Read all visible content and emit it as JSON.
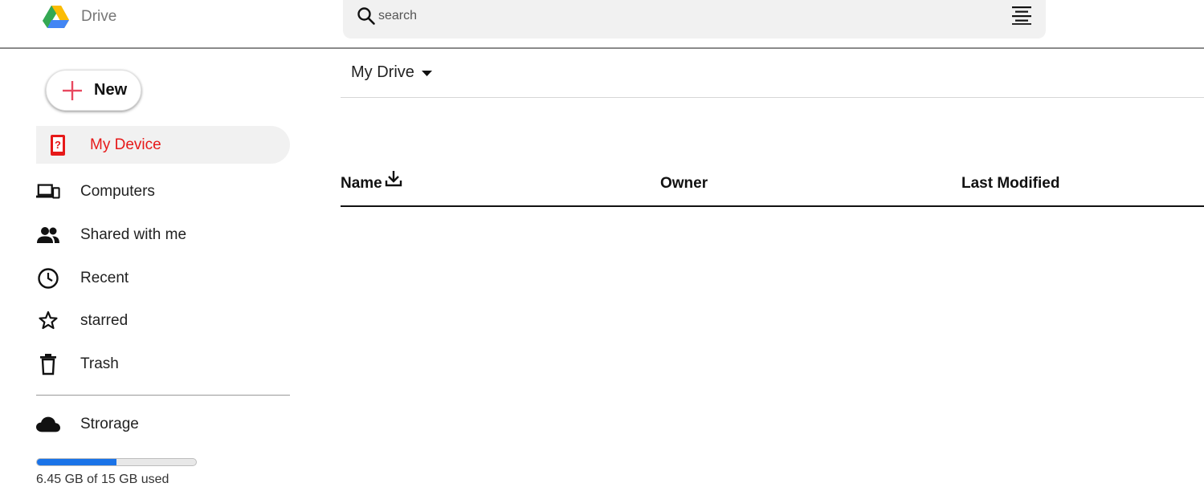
{
  "header": {
    "logo_icon": "google-drive-logo-icon",
    "title": "Drive",
    "search": {
      "placeholder": "search",
      "value": "",
      "icon": "search-icon"
    },
    "filter_icon": "filter-lines-icon"
  },
  "sidebar": {
    "new_button": {
      "label": "New",
      "icon": "plus-icon",
      "icon_color": "#e8485f"
    },
    "items": [
      {
        "label": "My Device",
        "icon": "device-icon",
        "active": true,
        "color": "#e61919"
      },
      {
        "label": "Computers",
        "icon": "computers-icon"
      },
      {
        "label": "Shared with me",
        "icon": "people-icon"
      },
      {
        "label": "Recent",
        "icon": "clock-icon"
      },
      {
        "label": "starred",
        "icon": "star-icon"
      },
      {
        "label": "Trash",
        "icon": "trash-icon"
      }
    ],
    "storage": {
      "label": "Strorage",
      "icon": "cloud-icon",
      "used_fraction": 0.5,
      "bar_color": "#1a73e8",
      "text": "6.45 GB of 15 GB used"
    }
  },
  "main": {
    "breadcrumb": "My Drive",
    "columns": [
      {
        "label": "Name",
        "icon": "download-icon"
      },
      {
        "label": "Owner"
      },
      {
        "label": "Last Modified"
      }
    ]
  }
}
